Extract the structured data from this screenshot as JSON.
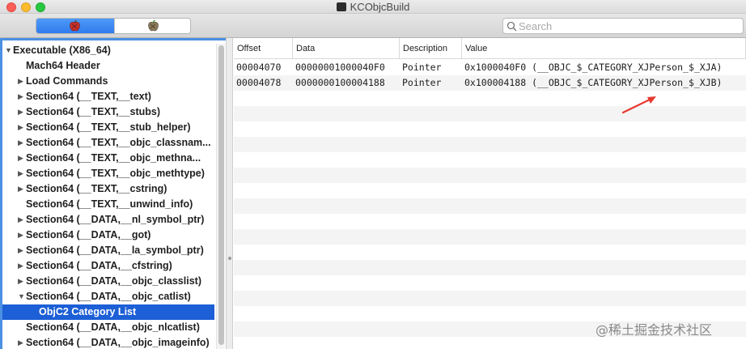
{
  "window": {
    "title": "KCObjcBuild",
    "colors": {
      "selection": "#1c5fd6",
      "focus_ring": "#4b90e2",
      "segment_active": "#2f7bed",
      "annotation_arrow": "#e8382f"
    }
  },
  "toolbar": {
    "segments": [
      {
        "icon": "red-apple-icon",
        "active": true
      },
      {
        "icon": "dim-apple-icon",
        "active": false
      }
    ],
    "search": {
      "placeholder": "Search",
      "value": ""
    }
  },
  "sidebar": {
    "items": [
      {
        "label": "Executable  (X86_64)",
        "disclosure": "▼",
        "level": 0
      },
      {
        "label": "Mach64 Header",
        "disclosure": "",
        "level": 1
      },
      {
        "label": "Load Commands",
        "disclosure": "▶",
        "level": 1
      },
      {
        "label": "Section64 (__TEXT,__text)",
        "disclosure": "▶",
        "level": 1
      },
      {
        "label": "Section64 (__TEXT,__stubs)",
        "disclosure": "▶",
        "level": 1
      },
      {
        "label": "Section64 (__TEXT,__stub_helper)",
        "disclosure": "▶",
        "level": 1
      },
      {
        "label": "Section64 (__TEXT,__objc_classnam...",
        "disclosure": "▶",
        "level": 1
      },
      {
        "label": "Section64 (__TEXT,__objc_methna...",
        "disclosure": "▶",
        "level": 1
      },
      {
        "label": "Section64 (__TEXT,__objc_methtype)",
        "disclosure": "▶",
        "level": 1
      },
      {
        "label": "Section64 (__TEXT,__cstring)",
        "disclosure": "▶",
        "level": 1
      },
      {
        "label": "Section64 (__TEXT,__unwind_info)",
        "disclosure": "",
        "level": 1
      },
      {
        "label": "Section64 (__DATA,__nl_symbol_ptr)",
        "disclosure": "▶",
        "level": 1
      },
      {
        "label": "Section64 (__DATA,__got)",
        "disclosure": "▶",
        "level": 1
      },
      {
        "label": "Section64 (__DATA,__la_symbol_ptr)",
        "disclosure": "▶",
        "level": 1
      },
      {
        "label": "Section64 (__DATA,__cfstring)",
        "disclosure": "▶",
        "level": 1
      },
      {
        "label": "Section64 (__DATA,__objc_classlist)",
        "disclosure": "▶",
        "level": 1
      },
      {
        "label": "Section64 (__DATA,__objc_catlist)",
        "disclosure": "▼",
        "level": 1
      },
      {
        "label": "ObjC2 Category List",
        "disclosure": "",
        "level": 2,
        "selected": true
      },
      {
        "label": "Section64 (__DATA,__objc_nlcatlist)",
        "disclosure": "",
        "level": 1
      },
      {
        "label": "Section64 (__DATA,__objc_imageinfo)",
        "disclosure": "▶",
        "level": 1
      }
    ]
  },
  "table": {
    "columns": [
      "Offset",
      "Data",
      "Description",
      "Value"
    ],
    "rows": [
      [
        "00004070",
        "00000001000040F0",
        "Pointer",
        "0x1000040F0 (__OBJC_$_CATEGORY_XJPerson_$_XJA)"
      ],
      [
        "00004078",
        "0000000100004188",
        "Pointer",
        "0x100004188 (__OBJC_$_CATEGORY_XJPerson_$_XJB)"
      ]
    ]
  },
  "watermark": "@稀土掘金技术社区"
}
